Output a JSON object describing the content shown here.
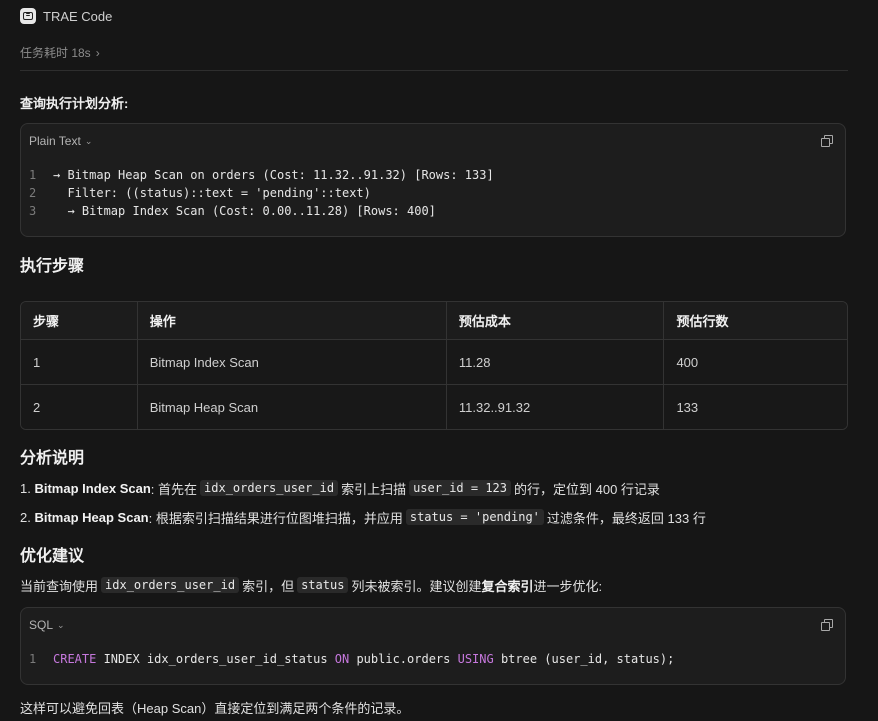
{
  "header": {
    "app_name": "TRAE Code"
  },
  "task": {
    "time_label": "任务耗时 18s"
  },
  "plan": {
    "heading": "查询执行计划分析:",
    "language": "Plain Text",
    "lines": [
      {
        "no": "1",
        "text": "→ Bitmap Heap Scan on orders (Cost: 11.32..91.32) [Rows: 133]"
      },
      {
        "no": "2",
        "text": "  Filter: ((status)::text = 'pending'::text)"
      },
      {
        "no": "3",
        "text": "  → Bitmap Index Scan (Cost: 0.00..11.28) [Rows: 400]"
      }
    ]
  },
  "steps": {
    "heading": "执行步骤",
    "columns": [
      "步骤",
      "操作",
      "预估成本",
      "预估行数"
    ],
    "rows": [
      [
        "1",
        "Bitmap Index Scan",
        "11.28",
        "400"
      ],
      [
        "2",
        "Bitmap Heap Scan",
        "11.32..91.32",
        "133"
      ]
    ]
  },
  "analysis": {
    "heading": "分析说明",
    "item1": {
      "prefix": "1. ",
      "title": "Bitmap Index Scan",
      "t1": ": 首先在",
      "c1": "idx_orders_user_id",
      "t2": "索引上扫描",
      "c2": "user_id = 123",
      "t3": "的行，定位到 400 行记录"
    },
    "item2": {
      "prefix": "2. ",
      "title": "Bitmap Heap Scan",
      "t1": ": 根据索引扫描结果进行位图堆扫描，并应用",
      "c1": "status = 'pending'",
      "t2": "过滤条件，最终返回 133 行"
    }
  },
  "optimize": {
    "heading": "优化建议",
    "p_t1": "当前查询使用",
    "p_c1": "idx_orders_user_id",
    "p_t2": "索引，但",
    "p_c2": "status",
    "p_t3": "列未被索引。建议创建",
    "p_b": "复合索引",
    "p_t4": "进一步优化:",
    "language": "SQL",
    "sql": {
      "no": "1",
      "kw1": "CREATE",
      "t1": " INDEX idx_orders_user_id_status ",
      "kw2": "ON",
      "t2": " public.orders ",
      "kw3": "USING",
      "t3": " btree (user_id, status);"
    },
    "footer": "这样可以避免回表（Heap Scan）直接定位到满足两个条件的记录。"
  },
  "colors": {
    "background": "#161616",
    "keyword": "#c678dd"
  }
}
